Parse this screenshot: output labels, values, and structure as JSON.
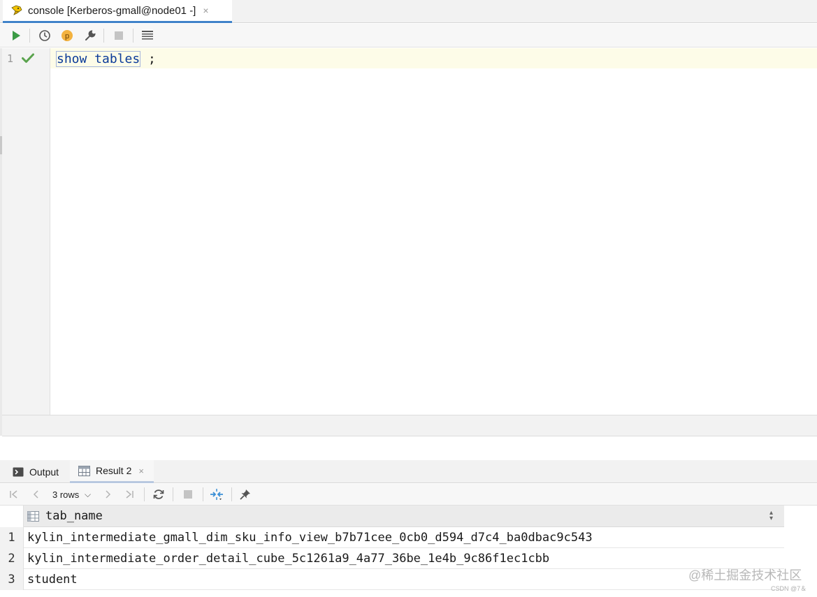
{
  "editor_tab": {
    "title": "console [Kerberos-gmall@node01 -]",
    "close": "×"
  },
  "toolbar": {
    "buttons": [
      "run-icon",
      "history-icon",
      "parameters-icon",
      "settings-wrench-icon",
      "stop-icon",
      "output-format-icon"
    ],
    "param_glyph": "p"
  },
  "editor": {
    "line_number": "1",
    "statement": "show tables",
    "terminator": " ;"
  },
  "panel_tabs": {
    "output_label": "Output",
    "result_label": "Result 2",
    "close": "×"
  },
  "result_toolbar": {
    "rows_label": "3 rows",
    "rows_chevron": "⌵"
  },
  "result_table": {
    "column": "tab_name",
    "rows": [
      {
        "num": "1",
        "value": "kylin_intermediate_gmall_dim_sku_info_view_b7b71cee_0cb0_d594_d7c4_ba0dbac9c543"
      },
      {
        "num": "2",
        "value": "kylin_intermediate_order_detail_cube_5c1261a9_4a77_36be_1e4b_9c86f1ec1cbb"
      },
      {
        "num": "3",
        "value": "student"
      }
    ]
  },
  "watermark": {
    "main": "@稀土掘金技术社区",
    "small": "CSDN @7＆"
  },
  "colors": {
    "accent": "#4083c9",
    "run": "#3b9b46",
    "check": "#5aa34d",
    "keyword": "#0a3a98"
  }
}
